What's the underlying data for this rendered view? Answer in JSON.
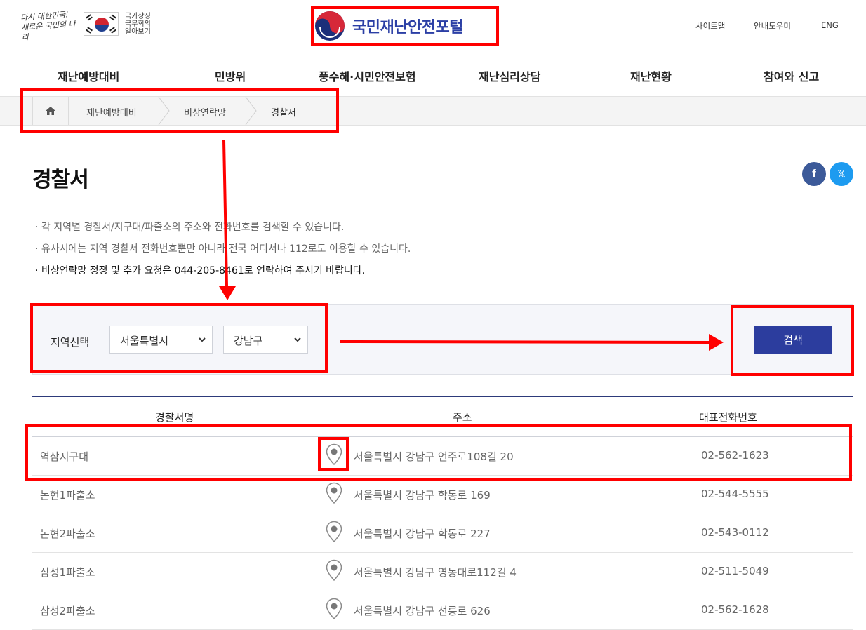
{
  "header": {
    "slogan": [
      "다시 대한민국!",
      "새로운 국민의 나라"
    ],
    "state_council": [
      "국가상징",
      "국무회의",
      "알아보기"
    ],
    "portal_title": "국민재난안전포털",
    "util_links": [
      "사이트맵",
      "안내도우미",
      "ENG"
    ]
  },
  "gnb": [
    "재난예방대비",
    "민방위",
    "풍수해·시민안전보험",
    "재난심리상담",
    "재난현황",
    "참여와 신고"
  ],
  "breadcrumb": [
    "재난예방대비",
    "비상연락망",
    "경찰서"
  ],
  "page": {
    "title": "경찰서",
    "notices": [
      "· 각 지역별 경찰서/지구대/파출소의 주소와 전화번호를 검색할 수 있습니다.",
      "· 유사시에는 지역 경찰서 전화번호뿐만 아니라 전국 어디서나 112로도 이용할 수 있습니다.",
      "· 비상연락망 정정 및 추가 요청은 044-205-8461로 연락하여 주시기 바랍니다."
    ]
  },
  "share": {
    "facebook": "f",
    "x": "𝕏"
  },
  "search": {
    "label": "지역선택",
    "city": "서울특별시",
    "district": "강남구",
    "button": "검색"
  },
  "table": {
    "headers": [
      "경찰서명",
      "주소",
      "대표전화번호"
    ],
    "rows": [
      {
        "name": "역삼지구대",
        "address": "서울특별시 강남구 언주로108길 20",
        "phone": "02-562-1623"
      },
      {
        "name": "논현1파출소",
        "address": "서울특별시 강남구 학동로 169",
        "phone": "02-544-5555"
      },
      {
        "name": "논현2파출소",
        "address": "서울특별시 강남구 학동로 227",
        "phone": "02-543-0112"
      },
      {
        "name": "삼성1파출소",
        "address": "서울특별시 강남구 영동대로112길 4",
        "phone": "02-511-5049"
      },
      {
        "name": "삼성2파출소",
        "address": "서울특별시 강남구 선릉로 626",
        "phone": "02-562-1628"
      }
    ]
  },
  "colors": {
    "brand": "#2b3fa5",
    "button": "#2c3d9e",
    "annotation": "#ff0000",
    "table_top": "#2d3a7a"
  }
}
